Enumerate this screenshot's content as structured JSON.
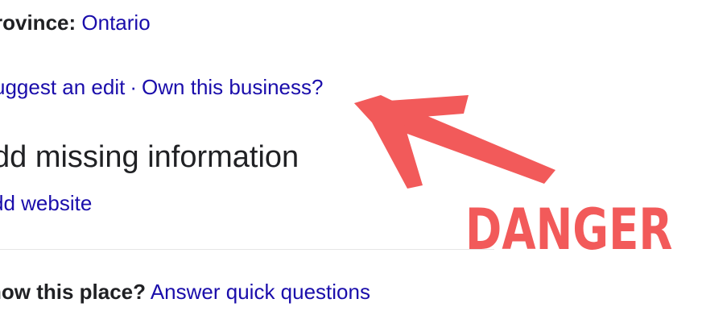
{
  "address": {
    "province_label": "rovince:",
    "province_value": "Ontario"
  },
  "actions": {
    "suggest_edit": "uggest an edit",
    "separator": "·",
    "own_business": "Own this business?"
  },
  "missing_info": {
    "title": "dd missing information",
    "add_website": "dd website"
  },
  "questions": {
    "prompt": "now this place?",
    "answer_link": "Answer quick questions"
  },
  "annotation": {
    "label": "DANGER",
    "color": "#f25a5a",
    "arrow_icon": "arrow-up-left-icon"
  },
  "colors": {
    "link": "#1a0dab",
    "text": "#202124",
    "divider": "#e6e6e6"
  }
}
